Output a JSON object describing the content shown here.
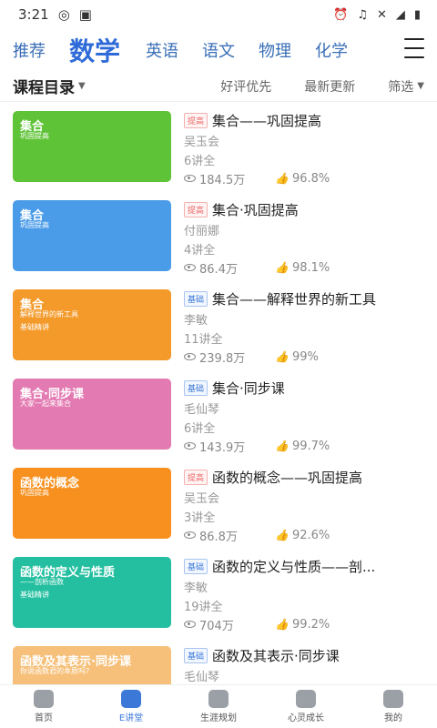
{
  "status": {
    "time": "3:21",
    "icons": [
      "weibo-icon",
      "image-icon",
      "alarm-icon",
      "headset-icon",
      "mute-icon",
      "signal-4g-icon",
      "battery-icon"
    ],
    "network": "4G"
  },
  "subjects": {
    "tabs": [
      {
        "label": "推荐"
      },
      {
        "label": "数学"
      },
      {
        "label": "英语"
      },
      {
        "label": "语文"
      },
      {
        "label": "物理"
      },
      {
        "label": "化学"
      }
    ],
    "active": "数学"
  },
  "filter": {
    "catalog": "课程目录",
    "sort_good": "好评优先",
    "sort_new": "最新更新",
    "filter": "筛选"
  },
  "courses": [
    {
      "thumb_title": "集合",
      "thumb_sub": "巩固提高",
      "thumb_sub2": "",
      "badge": "提高",
      "title": "集合——巩固提高",
      "teacher": "吴玉会",
      "lectures": "6讲全",
      "views": "184.5万",
      "rating": "96.8%",
      "bg": "#5fc337",
      "kind": "hi"
    },
    {
      "thumb_title": "集合",
      "thumb_sub": "巩固提高",
      "thumb_sub2": "",
      "badge": "提高",
      "title": "集合·巩固提高",
      "teacher": "付丽娜",
      "lectures": "4讲全",
      "views": "86.4万",
      "rating": "98.1%",
      "bg": "#4a9be8",
      "kind": "hi"
    },
    {
      "thumb_title": "集合",
      "thumb_sub": "解释世界的新工具",
      "thumb_sub2": "基础精讲",
      "badge": "基础",
      "title": "集合——解释世界的新工具",
      "teacher": "李敏",
      "lectures": "11讲全",
      "views": "239.8万",
      "rating": "99%",
      "bg": "#f39a2a",
      "kind": "base"
    },
    {
      "thumb_title": "集合·同步课",
      "thumb_sub": "大家一起来集合",
      "thumb_sub2": "",
      "badge": "基础",
      "title": "集合·同步课",
      "teacher": "毛仙琴",
      "lectures": "6讲全",
      "views": "143.9万",
      "rating": "99.7%",
      "bg": "#e37ab2",
      "kind": "base"
    },
    {
      "thumb_title": "函数的概念",
      "thumb_sub": "巩固提高",
      "thumb_sub2": "",
      "badge": "提高",
      "title": "函数的概念——巩固提高",
      "teacher": "吴玉会",
      "lectures": "3讲全",
      "views": "86.8万",
      "rating": "92.6%",
      "bg": "#f7901e",
      "kind": "hi"
    },
    {
      "thumb_title": "函数的定义与性质",
      "thumb_sub": "——剖析函数",
      "thumb_sub2": "基础精讲",
      "badge": "基础",
      "title": "函数的定义与性质——剖...",
      "teacher": "李敏",
      "lectures": "19讲全",
      "views": "704万",
      "rating": "99.2%",
      "bg": "#24bfa0",
      "kind": "base"
    },
    {
      "thumb_title": "函数及其表示·同步课",
      "thumb_sub": "你说函数君的本质吗?",
      "thumb_sub2": "",
      "badge": "基础",
      "title": "函数及其表示·同步课",
      "teacher": "毛仙琴",
      "lectures": "",
      "views": "",
      "rating": "",
      "bg": "#f6c07a",
      "kind": "base"
    }
  ],
  "nav": {
    "items": [
      {
        "label": "首页"
      },
      {
        "label": "E讲堂"
      },
      {
        "label": "生涯规划"
      },
      {
        "label": "心灵成长"
      },
      {
        "label": "我的"
      }
    ],
    "active": "E讲堂"
  }
}
